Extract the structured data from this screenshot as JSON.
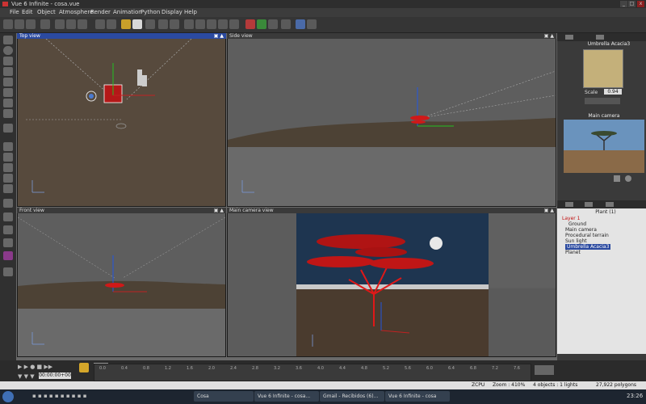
{
  "window": {
    "title": "Vue 6 Infinite - cosa.vue",
    "min": "_",
    "max": "□",
    "close": "x"
  },
  "menu": [
    "File",
    "Edit",
    "Object",
    "Atmosphere",
    "Render",
    "Animation",
    "Python",
    "Display",
    "Help"
  ],
  "viewports": {
    "top": {
      "title": "Top view"
    },
    "side": {
      "title": "Side view"
    },
    "front": {
      "title": "Front view"
    },
    "main": {
      "title": "Main camera view"
    }
  },
  "preview": {
    "name": "Umbrella Acacia3",
    "scale_label": "Scale",
    "scale_value": "0.94"
  },
  "camera_panel": {
    "title": "Main camera"
  },
  "world_browser": {
    "title": "Plant (1)",
    "items": [
      "Layer 1",
      "Ground",
      "Main camera",
      "Procedural terrain",
      "Sun light",
      "Umbrella Acacia3",
      "Planet"
    ]
  },
  "timeline": {
    "time": "00:00:00+00",
    "ticks": [
      "0.0",
      "0.4",
      "0.8",
      "1.2",
      "1.6",
      "2.0",
      "2.4",
      "2.8",
      "3.2",
      "3.6",
      "4.0",
      "4.4",
      "4.8",
      "5.2",
      "5.6",
      "6.0",
      "6.4",
      "6.8",
      "7.2",
      "7.6"
    ]
  },
  "status": {
    "zcpu": "ZCPU",
    "zoom": "Zoom : 410%",
    "objects": "4 objects : 1 lights",
    "polygons": "27,922 polygons"
  },
  "taskbar": {
    "tasks": [
      "Cosa",
      "Vue 6 Infinite - cosa...",
      "Gmail - Recibidos (6)...",
      "Vue 6 Infinite - cosa"
    ],
    "clock": "23:26"
  },
  "colors": {
    "viewport_active": "#2b4aa0",
    "tree": "#e01818",
    "terrain": "#5a4a3a"
  }
}
